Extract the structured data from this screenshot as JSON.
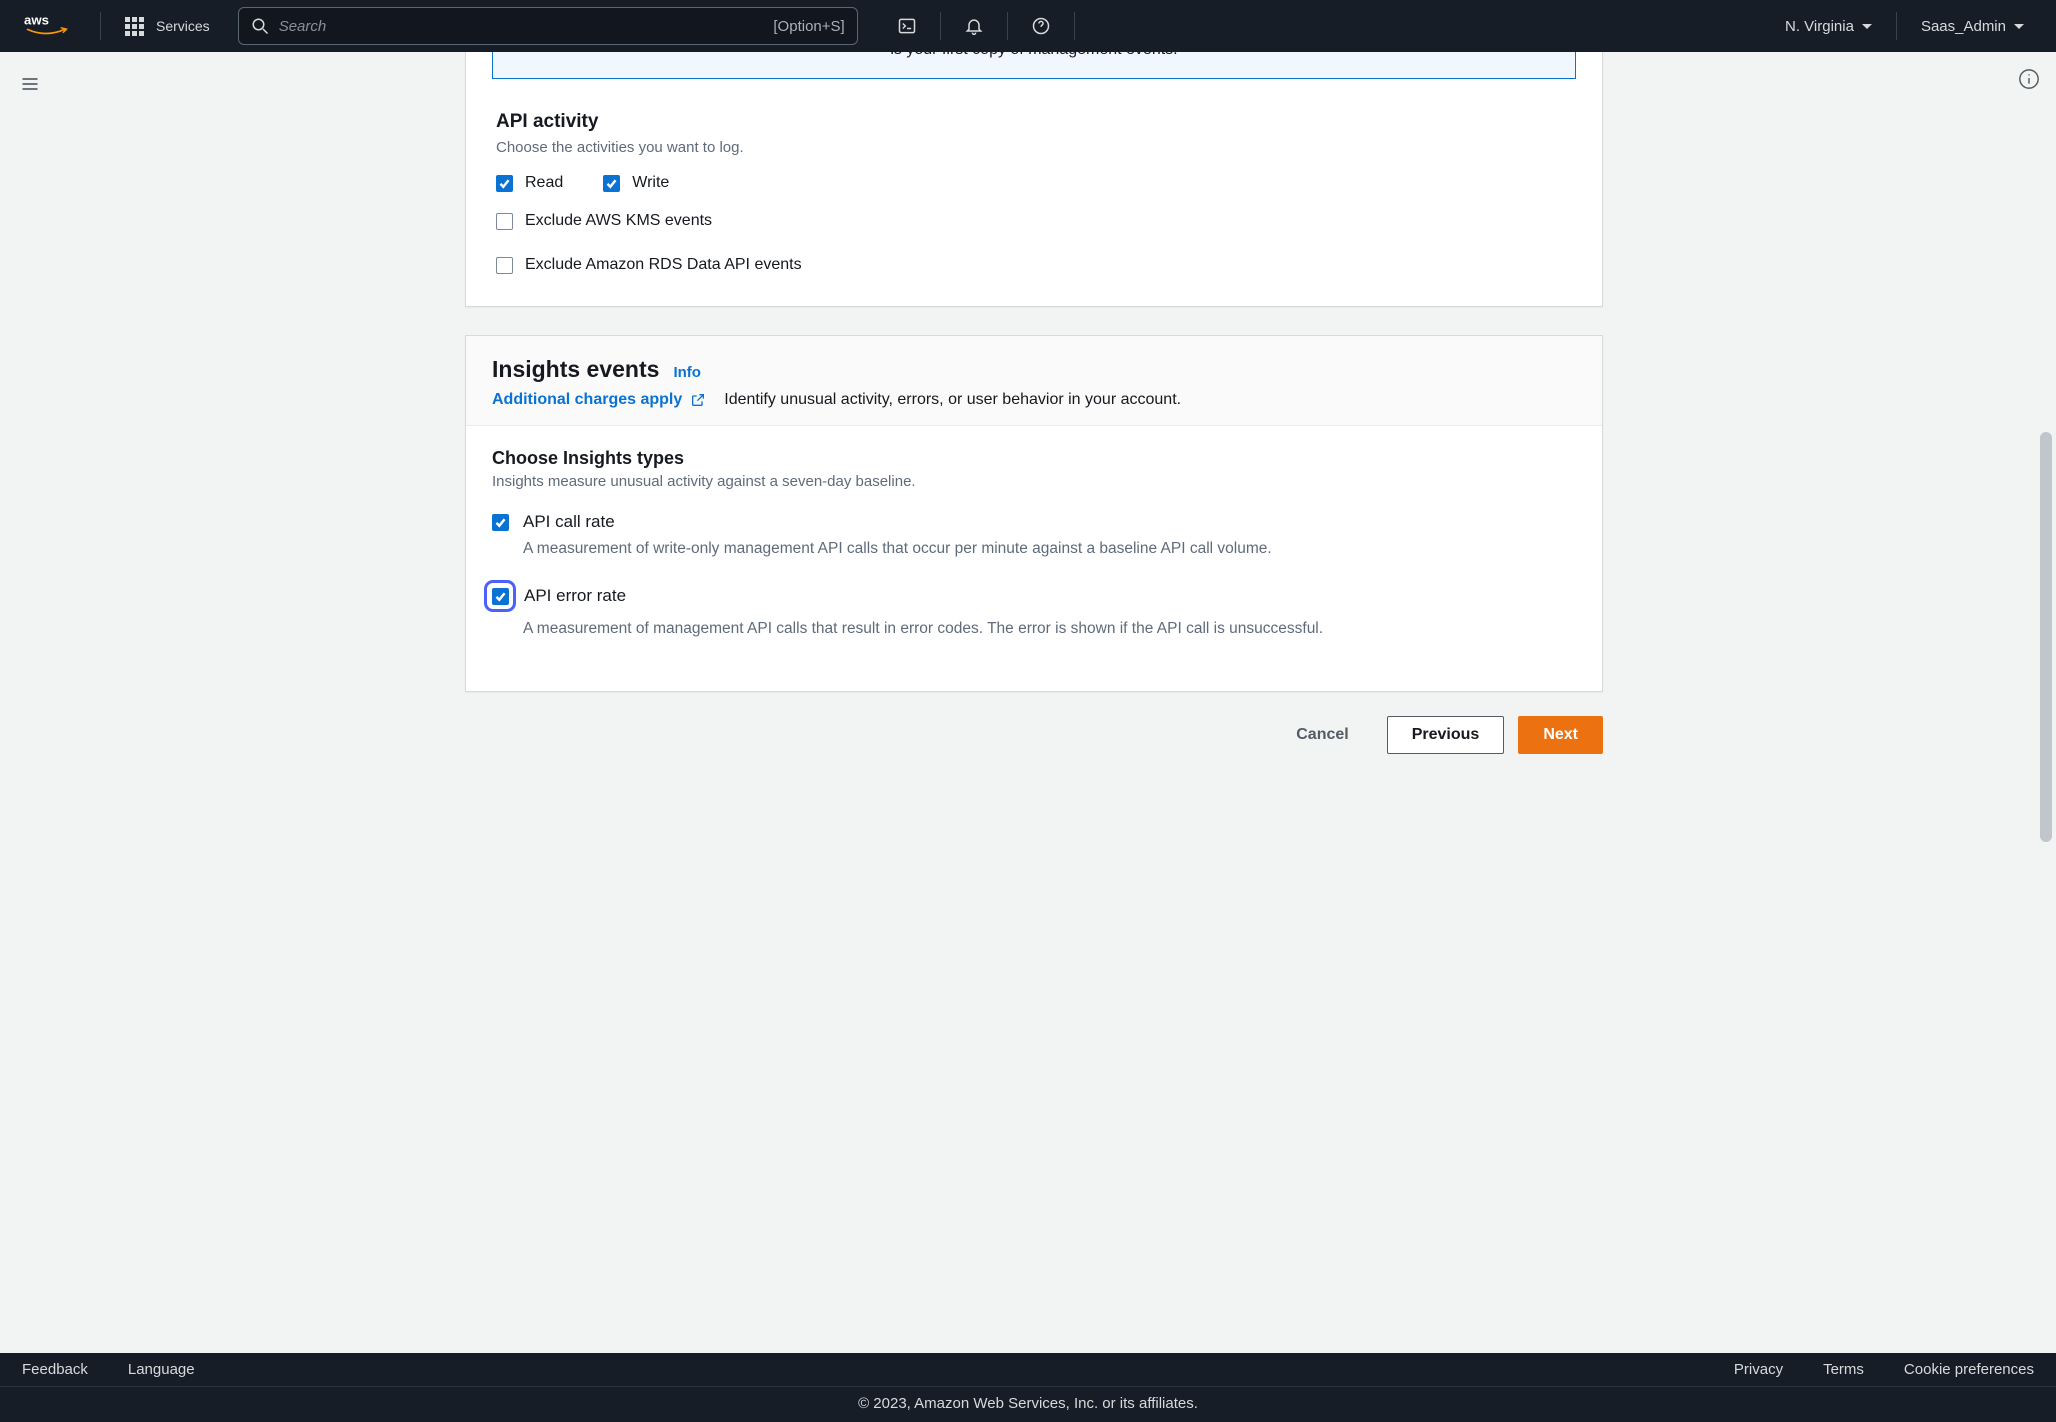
{
  "nav": {
    "services": "Services",
    "search_placeholder": "Search",
    "search_kbd": "[Option+S]",
    "region": "N. Virginia",
    "user": "Saas_Admin"
  },
  "alert": {
    "partial": "is your first copy of management events."
  },
  "api_activity": {
    "heading": "API activity",
    "sub": "Choose the activities you want to log.",
    "read": "Read",
    "write": "Write",
    "exclude_kms": "Exclude AWS KMS events",
    "exclude_rds": "Exclude Amazon RDS Data API events"
  },
  "insights": {
    "title": "Insights events",
    "info": "Info",
    "charges": "Additional charges apply",
    "desc": "Identify unusual activity, errors, or user behavior in your account.",
    "choose_h": "Choose Insights types",
    "choose_sub": "Insights measure unusual activity against a seven-day baseline.",
    "call_rate": "API call rate",
    "call_rate_desc": "A measurement of write-only management API calls that occur per minute against a baseline API call volume.",
    "error_rate": "API error rate",
    "error_rate_desc": "A measurement of management API calls that result in error codes. The error is shown if the API call is unsuccessful."
  },
  "actions": {
    "cancel": "Cancel",
    "previous": "Previous",
    "next": "Next"
  },
  "footer": {
    "feedback": "Feedback",
    "language": "Language",
    "privacy": "Privacy",
    "terms": "Terms",
    "cookie": "Cookie preferences",
    "copyright": "© 2023, Amazon Web Services, Inc. or its affiliates."
  }
}
